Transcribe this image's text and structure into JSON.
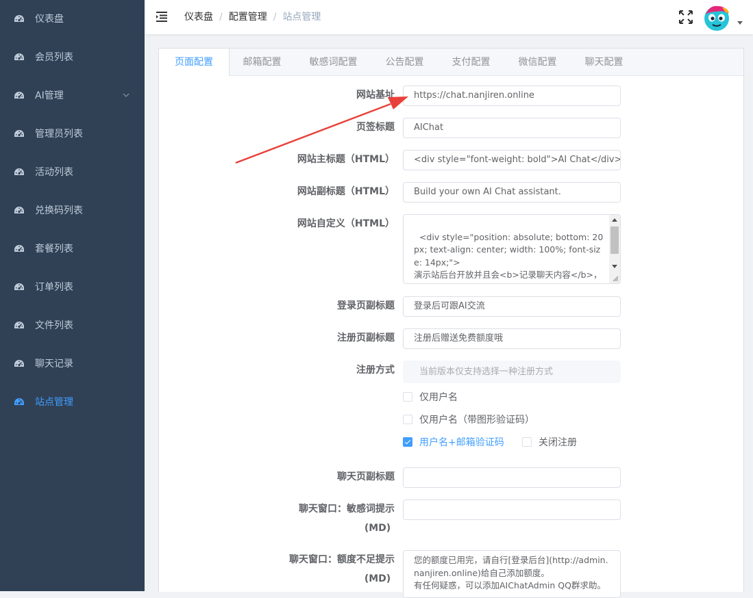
{
  "sidebar": {
    "items": [
      {
        "label": "仪表盘",
        "icon": "dashboard-icon",
        "active": false
      },
      {
        "label": "会员列表",
        "icon": "dashboard-icon",
        "active": false
      },
      {
        "label": "AI管理",
        "icon": "dashboard-icon",
        "active": false,
        "expandable": true
      },
      {
        "label": "管理员列表",
        "icon": "dashboard-icon",
        "active": false
      },
      {
        "label": "活动列表",
        "icon": "dashboard-icon",
        "active": false
      },
      {
        "label": "兑换码列表",
        "icon": "dashboard-icon",
        "active": false
      },
      {
        "label": "套餐列表",
        "icon": "dashboard-icon",
        "active": false
      },
      {
        "label": "订单列表",
        "icon": "dashboard-icon",
        "active": false
      },
      {
        "label": "文件列表",
        "icon": "dashboard-icon",
        "active": false
      },
      {
        "label": "聊天记录",
        "icon": "dashboard-icon",
        "active": false
      },
      {
        "label": "站点管理",
        "icon": "dashboard-icon",
        "active": true
      }
    ]
  },
  "header": {
    "breadcrumb": [
      "仪表盘",
      "配置管理",
      "站点管理"
    ],
    "icons": [
      "hamburger-icon",
      "fullscreen-icon",
      "avatar",
      "caret-down-icon"
    ]
  },
  "tabs": [
    {
      "label": "页面配置",
      "active": true
    },
    {
      "label": "邮箱配置",
      "active": false
    },
    {
      "label": "敏感词配置",
      "active": false
    },
    {
      "label": "公告配置",
      "active": false
    },
    {
      "label": "支付配置",
      "active": false
    },
    {
      "label": "微信配置",
      "active": false
    },
    {
      "label": "聊天配置",
      "active": false
    }
  ],
  "form": {
    "site_url": {
      "label": "网站基址",
      "value": "https://chat.nanjiren.online"
    },
    "page_title": {
      "label": "页签标题",
      "value": "AIChat"
    },
    "main_title": {
      "label": "网站主标题（HTML）",
      "value": "<div style=\"font-weight: bold\">AI Chat</div>"
    },
    "sub_title": {
      "label": "网站副标题（HTML）",
      "value": "Build your own AI Chat assistant."
    },
    "custom_html": {
      "label": "网站自定义（HTML）",
      "value": "<div style=\"position: absolute; bottom: 20px; text-align: center; width: 100%; font-size: 14px;\">\n演示站后台开放并且会<b>记录聊天内容</b>，请勿输入敏感，私密信息！"
    },
    "login_subtitle": {
      "label": "登录页副标题",
      "value": "登录后可跟AI交流"
    },
    "register_subtitle": {
      "label": "注册页副标题",
      "value": "注册后赠送免费额度哦"
    },
    "register_method": {
      "label": "注册方式",
      "placeholder": "当前版本仅支持选择一种注册方式",
      "options": [
        {
          "label": "仅用户名",
          "checked": false
        },
        {
          "label": "仅用户名（带图形验证码）",
          "checked": false
        },
        {
          "label": "用户名+邮箱验证码",
          "checked": true
        },
        {
          "label": "关闭注册",
          "checked": false
        }
      ]
    },
    "chat_subtitle": {
      "label": "聊天页副标题",
      "value": ""
    },
    "sensitive_tip": {
      "label_line1": "聊天窗口：敏感词提示",
      "label_line2": "(MD)",
      "value": ""
    },
    "quota_tip": {
      "label_line1": "聊天窗口：额度不足提示",
      "label_line2": "(MD)",
      "value": "您的额度已用完，请自行[登录后台](http://admin.nanjiren.online)给自己添加额度。\n有任何疑惑，可以添加AIChatAdmin QQ群求助。"
    }
  },
  "colors": {
    "sidebar_bg": "#304156",
    "accent": "#409eff",
    "arrow": "#e8413a"
  }
}
